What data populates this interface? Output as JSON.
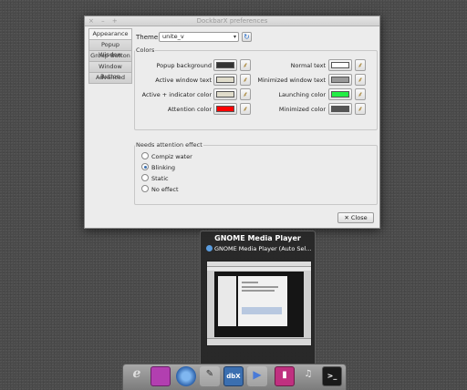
{
  "window": {
    "title": "DockbarX preferences",
    "controls": "× – +"
  },
  "tabs": [
    "Appearance",
    "Popup Window",
    "Group Button",
    "Window Button",
    "Advanced"
  ],
  "theme": {
    "label": "Theme:",
    "value": "unite_v"
  },
  "colors": {
    "legend": "Colors",
    "left": [
      {
        "label": "Popup background",
        "color": "#333333"
      },
      {
        "label": "Active window text",
        "color": "#e0dccb"
      },
      {
        "label": "Active + indicator color",
        "color": "#e0dccb"
      },
      {
        "label": "Attention color",
        "color": "#ff0000"
      }
    ],
    "right": [
      {
        "label": "Normal text",
        "color": "#ffffff"
      },
      {
        "label": "Minimized window text",
        "color": "#999999"
      },
      {
        "label": "Launching color",
        "color": "#22ee44"
      },
      {
        "label": "Minimized color",
        "color": "#555555"
      }
    ]
  },
  "attention": {
    "legend": "Needs attention effect",
    "options": [
      "Compiz water",
      "Blinking",
      "Static",
      "No effect"
    ],
    "selected": "Blinking"
  },
  "close_label": "✕ Close",
  "popup": {
    "title": "GNOME Media Player",
    "subtitle": "GNOME Media Player (Auto Sel..."
  },
  "dock": {
    "items": [
      "browser-icon",
      "purple-window-icon",
      "chromium-icon",
      "text-editor-icon",
      "dbx-icon",
      "media-player-icon",
      "recorder-icon",
      "mixer-icon",
      "terminal-icon"
    ]
  }
}
